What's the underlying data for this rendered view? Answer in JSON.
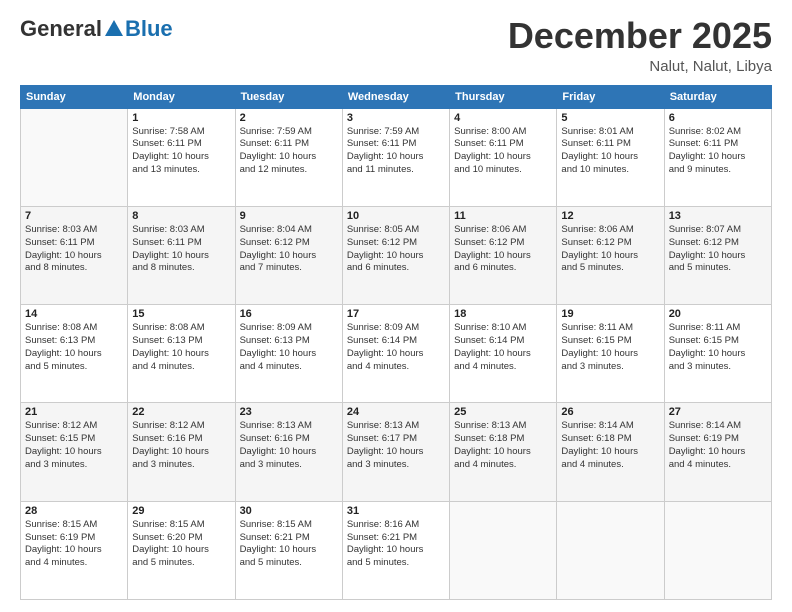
{
  "header": {
    "logo_general": "General",
    "logo_blue": "Blue",
    "month": "December 2025",
    "location": "Nalut, Nalut, Libya"
  },
  "weekdays": [
    "Sunday",
    "Monday",
    "Tuesday",
    "Wednesday",
    "Thursday",
    "Friday",
    "Saturday"
  ],
  "weeks": [
    [
      {
        "num": "",
        "info": ""
      },
      {
        "num": "1",
        "info": "Sunrise: 7:58 AM\nSunset: 6:11 PM\nDaylight: 10 hours\nand 13 minutes."
      },
      {
        "num": "2",
        "info": "Sunrise: 7:59 AM\nSunset: 6:11 PM\nDaylight: 10 hours\nand 12 minutes."
      },
      {
        "num": "3",
        "info": "Sunrise: 7:59 AM\nSunset: 6:11 PM\nDaylight: 10 hours\nand 11 minutes."
      },
      {
        "num": "4",
        "info": "Sunrise: 8:00 AM\nSunset: 6:11 PM\nDaylight: 10 hours\nand 10 minutes."
      },
      {
        "num": "5",
        "info": "Sunrise: 8:01 AM\nSunset: 6:11 PM\nDaylight: 10 hours\nand 10 minutes."
      },
      {
        "num": "6",
        "info": "Sunrise: 8:02 AM\nSunset: 6:11 PM\nDaylight: 10 hours\nand 9 minutes."
      }
    ],
    [
      {
        "num": "7",
        "info": "Sunrise: 8:03 AM\nSunset: 6:11 PM\nDaylight: 10 hours\nand 8 minutes."
      },
      {
        "num": "8",
        "info": "Sunrise: 8:03 AM\nSunset: 6:11 PM\nDaylight: 10 hours\nand 8 minutes."
      },
      {
        "num": "9",
        "info": "Sunrise: 8:04 AM\nSunset: 6:12 PM\nDaylight: 10 hours\nand 7 minutes."
      },
      {
        "num": "10",
        "info": "Sunrise: 8:05 AM\nSunset: 6:12 PM\nDaylight: 10 hours\nand 6 minutes."
      },
      {
        "num": "11",
        "info": "Sunrise: 8:06 AM\nSunset: 6:12 PM\nDaylight: 10 hours\nand 6 minutes."
      },
      {
        "num": "12",
        "info": "Sunrise: 8:06 AM\nSunset: 6:12 PM\nDaylight: 10 hours\nand 5 minutes."
      },
      {
        "num": "13",
        "info": "Sunrise: 8:07 AM\nSunset: 6:12 PM\nDaylight: 10 hours\nand 5 minutes."
      }
    ],
    [
      {
        "num": "14",
        "info": "Sunrise: 8:08 AM\nSunset: 6:13 PM\nDaylight: 10 hours\nand 5 minutes."
      },
      {
        "num": "15",
        "info": "Sunrise: 8:08 AM\nSunset: 6:13 PM\nDaylight: 10 hours\nand 4 minutes."
      },
      {
        "num": "16",
        "info": "Sunrise: 8:09 AM\nSunset: 6:13 PM\nDaylight: 10 hours\nand 4 minutes."
      },
      {
        "num": "17",
        "info": "Sunrise: 8:09 AM\nSunset: 6:14 PM\nDaylight: 10 hours\nand 4 minutes."
      },
      {
        "num": "18",
        "info": "Sunrise: 8:10 AM\nSunset: 6:14 PM\nDaylight: 10 hours\nand 4 minutes."
      },
      {
        "num": "19",
        "info": "Sunrise: 8:11 AM\nSunset: 6:15 PM\nDaylight: 10 hours\nand 3 minutes."
      },
      {
        "num": "20",
        "info": "Sunrise: 8:11 AM\nSunset: 6:15 PM\nDaylight: 10 hours\nand 3 minutes."
      }
    ],
    [
      {
        "num": "21",
        "info": "Sunrise: 8:12 AM\nSunset: 6:15 PM\nDaylight: 10 hours\nand 3 minutes."
      },
      {
        "num": "22",
        "info": "Sunrise: 8:12 AM\nSunset: 6:16 PM\nDaylight: 10 hours\nand 3 minutes."
      },
      {
        "num": "23",
        "info": "Sunrise: 8:13 AM\nSunset: 6:16 PM\nDaylight: 10 hours\nand 3 minutes."
      },
      {
        "num": "24",
        "info": "Sunrise: 8:13 AM\nSunset: 6:17 PM\nDaylight: 10 hours\nand 3 minutes."
      },
      {
        "num": "25",
        "info": "Sunrise: 8:13 AM\nSunset: 6:18 PM\nDaylight: 10 hours\nand 4 minutes."
      },
      {
        "num": "26",
        "info": "Sunrise: 8:14 AM\nSunset: 6:18 PM\nDaylight: 10 hours\nand 4 minutes."
      },
      {
        "num": "27",
        "info": "Sunrise: 8:14 AM\nSunset: 6:19 PM\nDaylight: 10 hours\nand 4 minutes."
      }
    ],
    [
      {
        "num": "28",
        "info": "Sunrise: 8:15 AM\nSunset: 6:19 PM\nDaylight: 10 hours\nand 4 minutes."
      },
      {
        "num": "29",
        "info": "Sunrise: 8:15 AM\nSunset: 6:20 PM\nDaylight: 10 hours\nand 5 minutes."
      },
      {
        "num": "30",
        "info": "Sunrise: 8:15 AM\nSunset: 6:21 PM\nDaylight: 10 hours\nand 5 minutes."
      },
      {
        "num": "31",
        "info": "Sunrise: 8:16 AM\nSunset: 6:21 PM\nDaylight: 10 hours\nand 5 minutes."
      },
      {
        "num": "",
        "info": ""
      },
      {
        "num": "",
        "info": ""
      },
      {
        "num": "",
        "info": ""
      }
    ]
  ]
}
